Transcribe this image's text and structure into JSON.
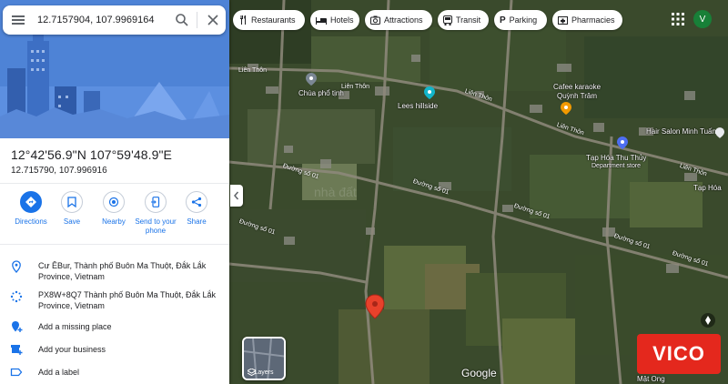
{
  "search": {
    "value": "12.7157904, 107.9969164"
  },
  "place": {
    "coords_dms": "12°42'56.9\"N 107°59'48.9\"E",
    "coords_decimal": "12.715790, 107.996916"
  },
  "actions": [
    {
      "label": "Directions",
      "icon": "directions-icon"
    },
    {
      "label": "Save",
      "icon": "bookmark-icon"
    },
    {
      "label": "Nearby",
      "icon": "nearby-icon"
    },
    {
      "label": "Send to your phone",
      "icon": "send-to-phone-icon"
    },
    {
      "label": "Share",
      "icon": "share-icon"
    }
  ],
  "info": {
    "address": "Cư ÊBur, Thành phố Buôn Ma Thuột, Đắk Lắk Province, Vietnam",
    "plus_code": "PX8W+8Q7 Thành phố Buôn Ma Thuột, Đắk Lắk Province, Vietnam",
    "add_missing_place": "Add a missing place",
    "add_business": "Add your business",
    "add_label": "Add a label"
  },
  "chips": [
    {
      "label": "Restaurants",
      "icon": "fork-knife-icon"
    },
    {
      "label": "Hotels",
      "icon": "bed-icon"
    },
    {
      "label": "Attractions",
      "icon": "camera-icon"
    },
    {
      "label": "Transit",
      "icon": "bus-icon"
    },
    {
      "label": "Parking",
      "icon": "parking-icon"
    },
    {
      "label": "Pharmacies",
      "icon": "pharmacy-icon"
    }
  ],
  "user": {
    "initial": "V",
    "color": "#188038"
  },
  "map": {
    "places": {
      "chua_pho_tinh": "Chùa phổ tịnh",
      "lees_hillside": "Lees hillside",
      "cafe_karaoke": "Cafee karaoke\nQuỳnh Trâm",
      "hair_salon": "Hair Salon Minh Tuấn",
      "tap_hoa": "Tạp Hóa Thu Thủy",
      "department_store": "Department store",
      "tap_hoa_right": "Tạp Hóa",
      "mat_ong": "Mật Ong"
    },
    "roads": {
      "lien_thon_1": "Liên Thôn",
      "lien_thon_2": "Liên Thôn",
      "lien_thon_3": "Liên Thôn",
      "lien_thon_4": "Liên Thôn",
      "lien_thon_5": "Liên Thôn",
      "duong_so_1": "Đường số 01",
      "duong_so_2": "Đường số 01",
      "duong_so_3": "Đường số 01",
      "duong_so_4": "Đường số 01",
      "duong_so_5": "Đường số 01",
      "duong_so_6": "Đường số 01"
    },
    "layers_label": "Layers",
    "google_logo": "Google",
    "brand_badge": "VICO",
    "colors": {
      "pin": "#e8412b",
      "accent": "#1a73e8"
    }
  }
}
